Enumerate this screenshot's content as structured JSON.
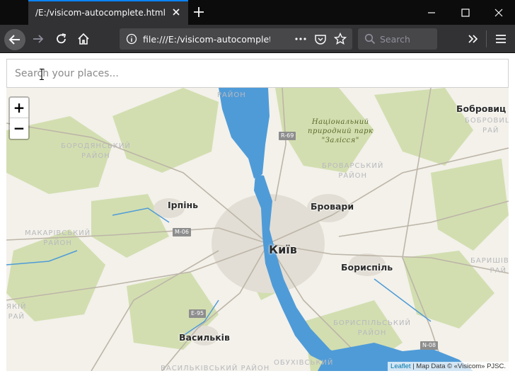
{
  "browser": {
    "tab_title": "/E:/visicom-autocomplete.html",
    "url": "file:///E:/visicom-autocomplete.html",
    "search_placeholder": "Search"
  },
  "app": {
    "search_placeholder": "Search your places..."
  },
  "map": {
    "zoom_in": "+",
    "zoom_out": "−",
    "cities": [
      {
        "name": "Київ"
      },
      {
        "name": "Ірпінь"
      },
      {
        "name": "Бровари"
      },
      {
        "name": "Бориспіль"
      },
      {
        "name": "Васильків"
      },
      {
        "name": "Бобровиц"
      }
    ],
    "districts": [
      "БОРОДЯНСЬКИЙ\nРАЙОН",
      "МАКАРІВСЬКИЙ\nРАЙОН",
      "БРОВАРСЬКИЙ\nРАЙОН",
      "БОРИСПІЛЬСЬКИЙ\nРАЙОН",
      "БАРИШІВСЬК\nРАЙ",
      "БОБРОВИЦЬ\nРАЙ",
      "РАЙОН",
      "ВАСИЛЬКІВСЬКИЙ РАЙОН",
      "ОБУХІВСЬКИЙ",
      "ЯКІЙ\nРАЙ"
    ],
    "park_label": "Національний\nприродний парк\n\"Залісся\"",
    "road_shields": [
      "R-69",
      "M-06",
      "E-95",
      "N-08"
    ],
    "attribution_link": "Leaflet",
    "attribution_text": " | Map Data © «Visicom» PJSC."
  }
}
